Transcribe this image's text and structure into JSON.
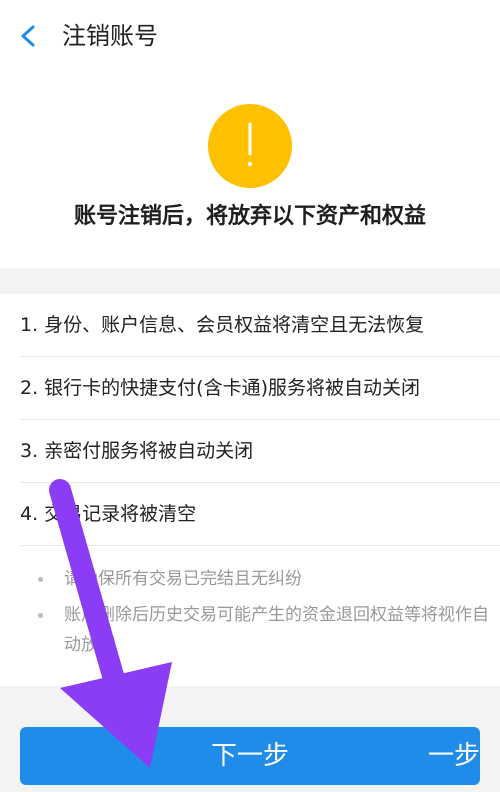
{
  "header": {
    "title": "注销账号"
  },
  "warning": {
    "icon_glyph": "!",
    "heading": "账号注销后，将放弃以下资产和权益"
  },
  "items": [
    {
      "label": "1. 身份、账户信息、会员权益将清空且无法恢复"
    },
    {
      "label": "2. 银行卡的快捷支付(含卡通)服务将被自动关闭"
    },
    {
      "label": "3. 亲密付服务将被自动关闭"
    },
    {
      "label": "4. 交易记录将被清空"
    }
  ],
  "notes": [
    {
      "text": "请确保所有交易已完结且无纠纷"
    },
    {
      "text": "账户删除后历史交易可能产生的资金退回权益等将视作自动放弃"
    }
  ],
  "footer": {
    "next_label": "下一步",
    "next_ghost": "一步"
  },
  "colors": {
    "accent": "#1E8CE8",
    "warning": "#FFC000",
    "annotation_arrow": "#8B3CF5"
  },
  "icons": [
    "back-chevron-icon",
    "warning-exclamation-icon",
    "bullet-dot-icon",
    "annotation-arrow-icon"
  ]
}
